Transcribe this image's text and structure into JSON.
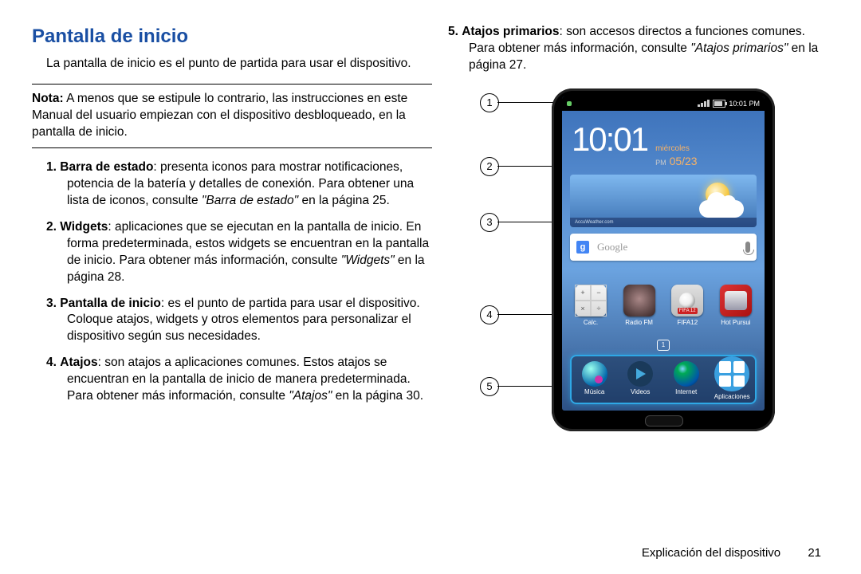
{
  "title": "Pantalla de inicio",
  "intro": "La pantalla de inicio es el punto de partida para usar el dispositivo.",
  "note": {
    "label": "Nota:",
    "body": "A menos que se estipule lo contrario, las instrucciones en este Manual del usuario empiezan con el dispositivo desbloqueado, en la pantalla de inicio."
  },
  "items": [
    {
      "num": "1.",
      "term": "Barra de estado",
      "text": ": presenta iconos para mostrar notificaciones, potencia de la batería y detalles de conexión. Para obtener una lista de iconos, consulte ",
      "ref": "\"Barra de estado\"",
      "tail": " en la página 25."
    },
    {
      "num": "2.",
      "term": "Widgets",
      "text": ": aplicaciones que se ejecutan en la pantalla de inicio. En forma predeterminada, estos widgets se encuentran en la pantalla de inicio. Para obtener más información, consulte ",
      "ref": "\"Widgets\"",
      "tail": " en la página 28."
    },
    {
      "num": "3.",
      "term": "Pantalla de inicio",
      "text": ": es el punto de partida para usar el dispositivo. Coloque atajos, widgets y otros elementos para personalizar el dispositivo según sus necesidades.",
      "ref": "",
      "tail": ""
    },
    {
      "num": "4.",
      "term": "Atajos",
      "text": ": son atajos a aplicaciones comunes. Estos atajos se encuentran en la pantalla de inicio de manera predeterminada. Para obtener más información, consulte ",
      "ref": "\"Atajos\"",
      "tail": " en la página 30."
    }
  ],
  "item5": {
    "num": "5.",
    "term": "Atajos primarios",
    "text": ": son accesos directos a funciones comunes. Para obtener más información, consulte ",
    "ref": "\"Atajos primarios\"",
    "tail": " en la página 27."
  },
  "callouts": [
    "1",
    "2",
    "3",
    "4",
    "5"
  ],
  "phone": {
    "status_time": "10:01 PM",
    "clock_time": "10:01",
    "clock_ampm": "PM",
    "clock_day": "miércoles",
    "clock_date": "05/23",
    "weather_brand": "AccuWeather.com",
    "search_hint": "Google",
    "search_logo": "g",
    "pager": "1",
    "apps": [
      {
        "label": "Calc.",
        "sym": [
          "+",
          "−",
          "×",
          "÷"
        ]
      },
      {
        "label": "Radio FM"
      },
      {
        "label": "FIFA12",
        "tag": "FIFA 12"
      },
      {
        "label": "Hot Pursui"
      }
    ],
    "dock": [
      {
        "label": "Música"
      },
      {
        "label": "Videos"
      },
      {
        "label": "Internet"
      },
      {
        "label": "Aplicaciones"
      }
    ]
  },
  "footer": {
    "section": "Explicación del dispositivo",
    "page": "21"
  }
}
